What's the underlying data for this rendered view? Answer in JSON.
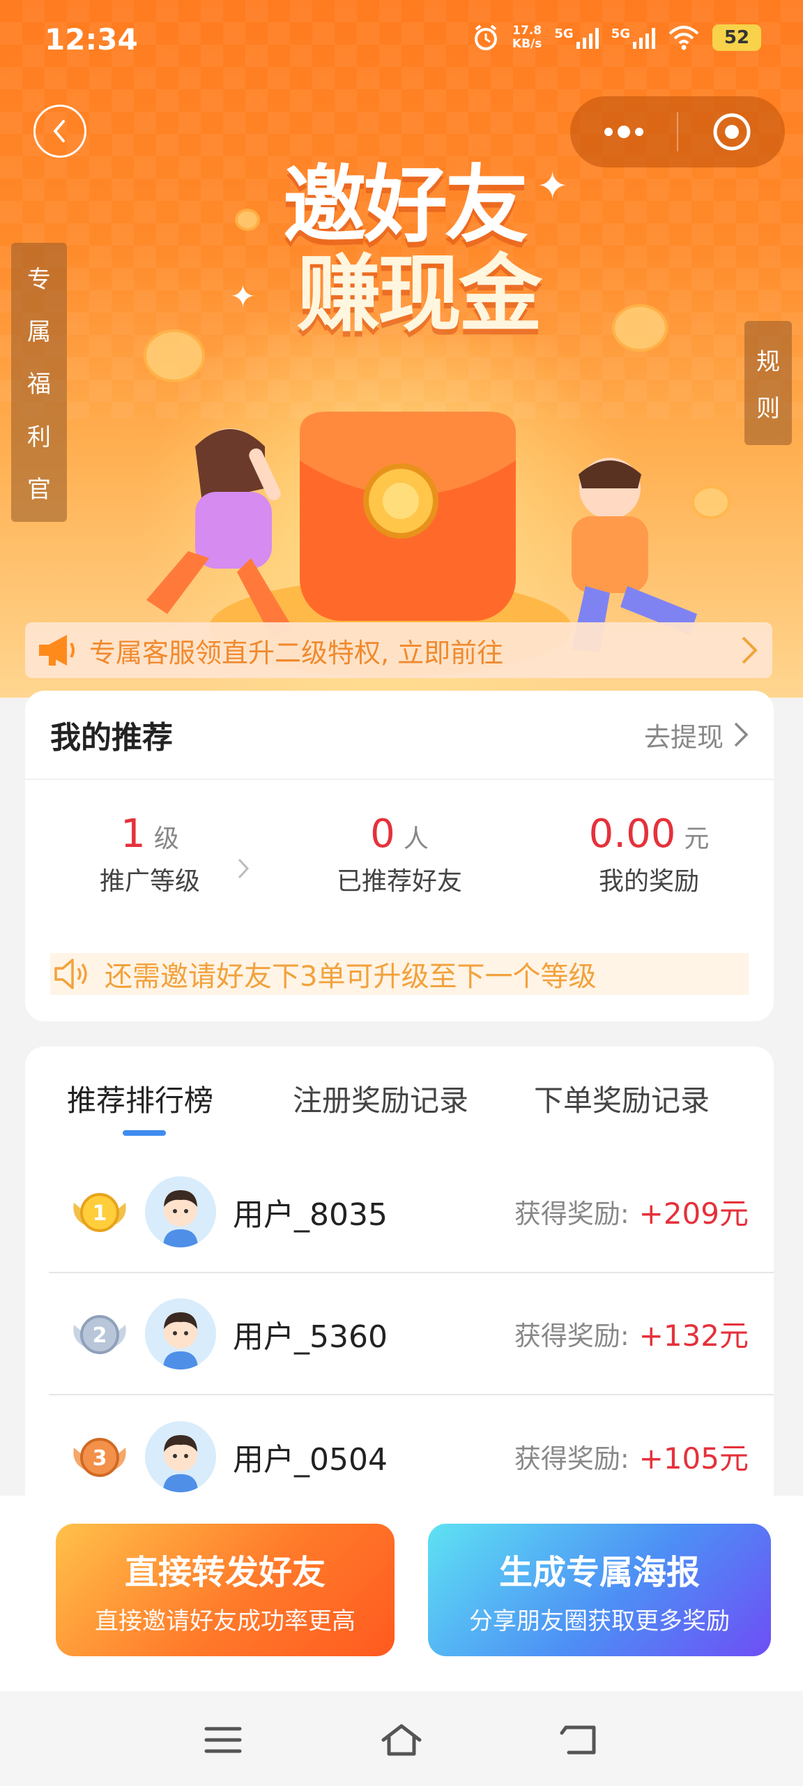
{
  "status_bar": {
    "time": "12:34",
    "net_speed_value": "17.8",
    "net_speed_unit": "KB/s",
    "signal1": "5G",
    "signal2": "5G",
    "battery": "52"
  },
  "hero": {
    "title_line1": "邀好友",
    "title_line2": "赚现金"
  },
  "side_tabs": {
    "left_chars": [
      "专",
      "属",
      "福",
      "利",
      "官"
    ],
    "right_chars": [
      "规",
      "则"
    ]
  },
  "notice": {
    "text": "专属客服领直升二级特权, 立即前往"
  },
  "recommend": {
    "title": "我的推荐",
    "withdraw_label": "去提现",
    "stats": [
      {
        "value": "1",
        "unit": "级",
        "label": "推广等级"
      },
      {
        "value": "0",
        "unit": "人",
        "label": "已推荐好友"
      },
      {
        "value": "0.00",
        "unit": "元",
        "label": "我的奖励"
      }
    ],
    "upgrade_tip": "还需邀请好友下3单可升级至下一个等级"
  },
  "tabs": [
    "推荐排行榜",
    "注册奖励记录",
    "下单奖励记录"
  ],
  "ranking": [
    {
      "rank": "1",
      "name": "用户_8035",
      "reward_label": "获得奖励:",
      "reward": "+209元"
    },
    {
      "rank": "2",
      "name": "用户_5360",
      "reward_label": "获得奖励:",
      "reward": "+132元"
    },
    {
      "rank": "3",
      "name": "用户_0504",
      "reward_label": "获得奖励:",
      "reward": "+105元"
    }
  ],
  "buttons": {
    "share_title": "直接转发好友",
    "share_sub": "直接邀请好友成功率更高",
    "poster_title": "生成专属海报",
    "poster_sub": "分享朋友圈获取更多奖励"
  },
  "colors": {
    "hero_orange": "#ff7b1f",
    "accent_red": "#e5313b",
    "tab_indicator": "#3f8cf0",
    "tip_orange": "#f2a23c"
  },
  "icons": [
    "back-arrow-icon",
    "more-dots-icon",
    "target-icon",
    "megaphone-icon",
    "chevron-right-icon",
    "speaker-icon",
    "gold-medal-icon",
    "silver-medal-icon",
    "bronze-medal-icon",
    "avatar-icon",
    "menu-icon",
    "home-icon",
    "back-icon"
  ]
}
